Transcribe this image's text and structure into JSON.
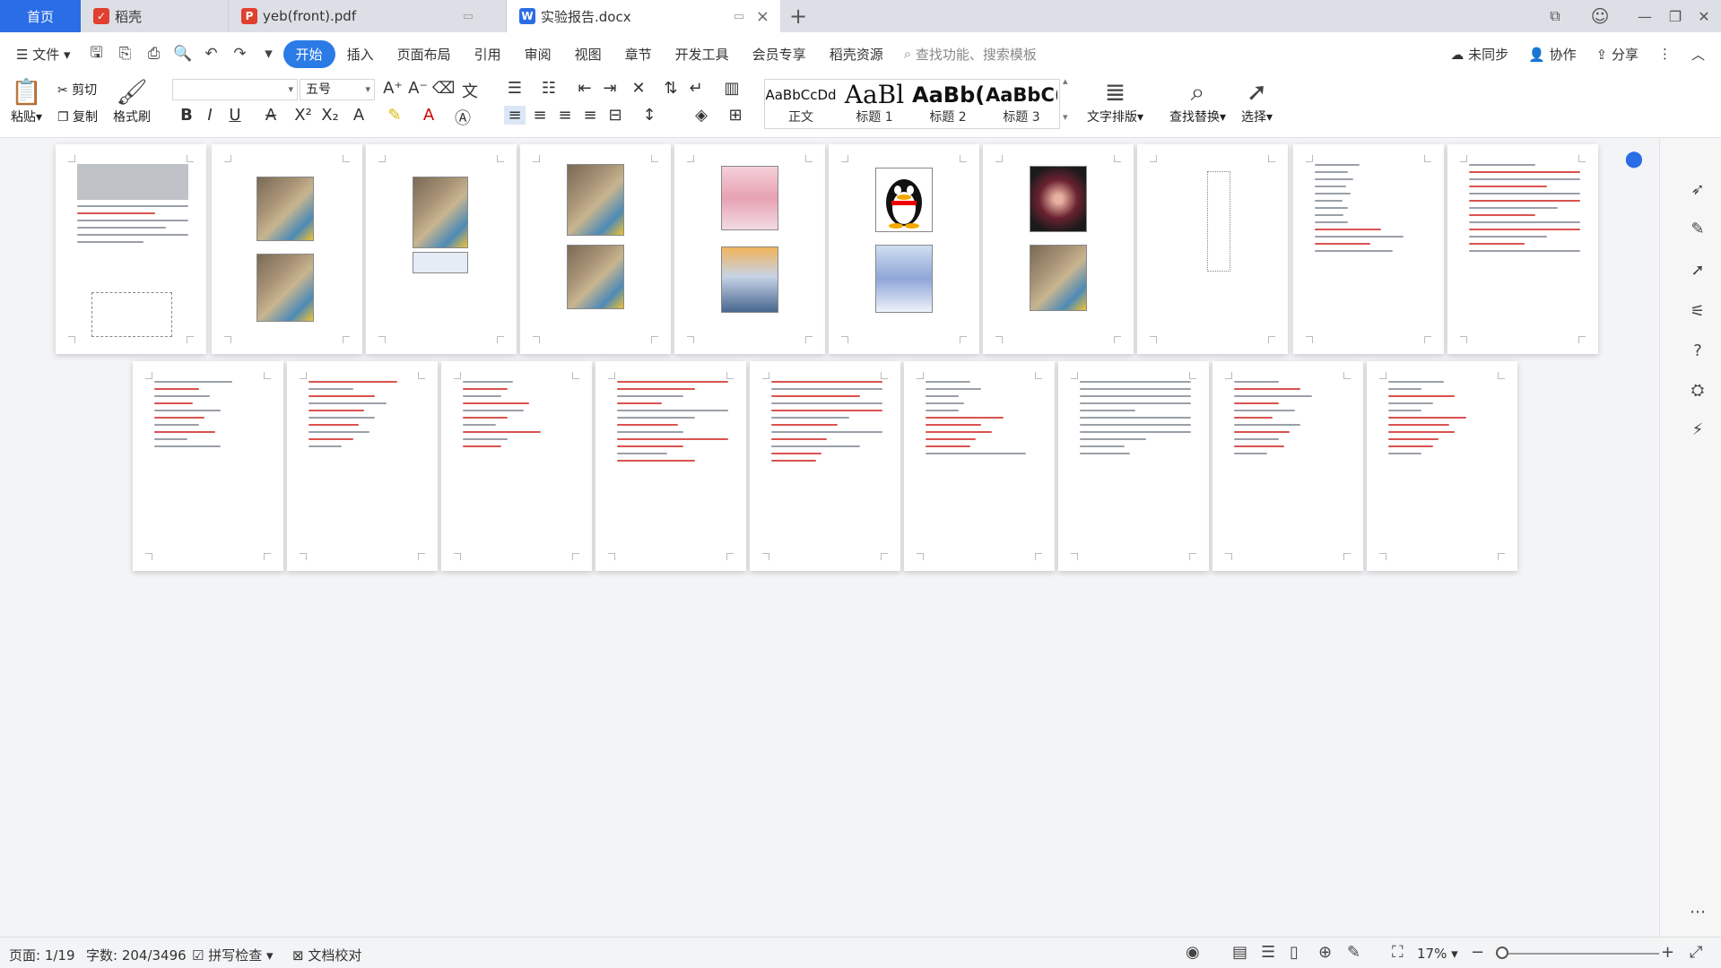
{
  "tabs": {
    "home": "首页",
    "t1": "稻壳",
    "t2": "yeb(front).pdf",
    "t3": "实验报告.docx"
  },
  "menubar": {
    "file": "文件",
    "items": [
      "开始",
      "插入",
      "页面布局",
      "引用",
      "审阅",
      "视图",
      "章节",
      "开发工具",
      "会员专享",
      "稻壳资源"
    ],
    "search_placeholder": "查找功能、搜索模板",
    "sync": "未同步",
    "collab": "协作",
    "share": "分享"
  },
  "ribbon": {
    "paste": "粘贴",
    "cut": "剪切",
    "copy": "复制",
    "format_painter": "格式刷",
    "font_name": "",
    "font_size": "五号",
    "styles": [
      {
        "sample": "AaBbCcDd",
        "name": "正文"
      },
      {
        "sample": "AaBl",
        "name": "标题 1"
      },
      {
        "sample": "AaBb(",
        "name": "标题 2"
      },
      {
        "sample": "AaBbC(",
        "name": "标题 3"
      }
    ],
    "text_layout": "文字排版",
    "find_replace": "查找替换",
    "select": "选择"
  },
  "status": {
    "page": "页面: 1/19",
    "words": "字数: 204/3496",
    "spell": "拼写检查",
    "proof": "文档校对",
    "zoom": "17%"
  },
  "colors": {
    "accent": "#2b6de6",
    "active_menu": "#2b7be6",
    "tab_bg": "#dcdfe5",
    "wps_red": "#e0402f"
  }
}
